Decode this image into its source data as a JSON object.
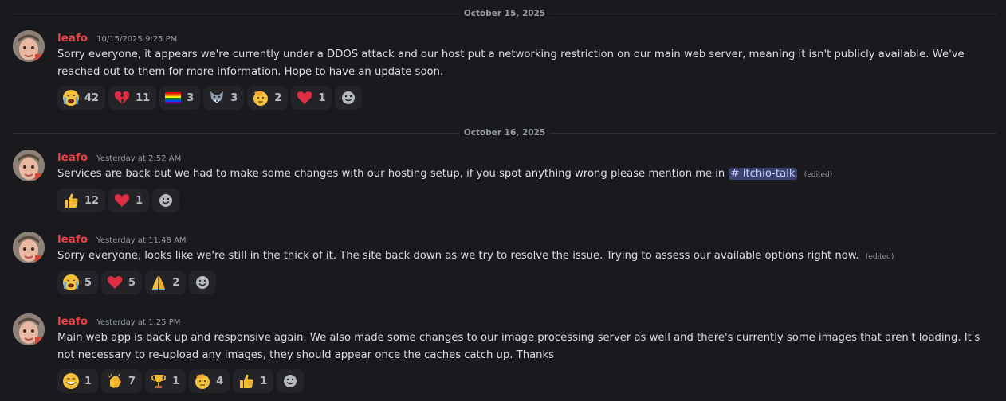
{
  "dividers": [
    "October 15, 2025",
    "October 16, 2025"
  ],
  "messages": [
    {
      "author": "leafo",
      "timestamp": "10/15/2025 9:25 PM",
      "text": "Sorry everyone, it appears we're currently under a DDOS attack and our host put a networking restriction on our main web server, meaning it isn't publicly available. We've reached out to them for more information. Hope to have an update soon.",
      "reactions": [
        {
          "emoji": "loudly-crying-face-icon",
          "count": "42"
        },
        {
          "emoji": "broken-heart-icon",
          "count": "11"
        },
        {
          "emoji": "rainbow-flag-icon",
          "count": "3"
        },
        {
          "emoji": "wolf-icon",
          "count": "3"
        },
        {
          "emoji": "saluting-face-icon",
          "count": "2"
        },
        {
          "emoji": "red-heart-icon",
          "count": "1"
        }
      ]
    },
    {
      "author": "leafo",
      "timestamp": "Yesterday at 2:52 AM",
      "text": "Services are back but we had to make some changes with our hosting setup, if you spot anything wrong please mention me in",
      "mention": "# itchio-talk",
      "edited": "(edited)",
      "reactions": [
        {
          "emoji": "thumbs-up-icon",
          "count": "12"
        },
        {
          "emoji": "red-heart-icon",
          "count": "1"
        }
      ]
    },
    {
      "author": "leafo",
      "timestamp": "Yesterday at 11:48 AM",
      "text": "Sorry everyone, looks like we're still in the thick of it. The site back down as we try to resolve the issue. Trying to assess our available options right now.",
      "edited": "(edited)",
      "reactions": [
        {
          "emoji": "loudly-crying-face-icon",
          "count": "5"
        },
        {
          "emoji": "red-heart-icon",
          "count": "5"
        },
        {
          "emoji": "folded-hands-icon",
          "count": "2"
        }
      ]
    },
    {
      "author": "leafo",
      "timestamp": "Yesterday at 1:25 PM",
      "text": "Main web app is back up and responsive again. We also made some changes to our image processing server as well and there's currently some images that aren't loading. It's not necessary to re-upload any images, they should appear once the caches catch up. Thanks",
      "reactions": [
        {
          "emoji": "grinning-face-icon",
          "count": "1"
        },
        {
          "emoji": "clapping-hands-icon",
          "count": "7"
        },
        {
          "emoji": "trophy-icon",
          "count": "1"
        },
        {
          "emoji": "saluting-face-icon",
          "count": "4"
        },
        {
          "emoji": "thumbs-up-icon",
          "count": "1"
        }
      ]
    }
  ],
  "colors": {
    "background": "#1a1a1e",
    "author": "#ed4245",
    "mention_bg": "#3c4270",
    "reaction_bg": "#242428"
  }
}
